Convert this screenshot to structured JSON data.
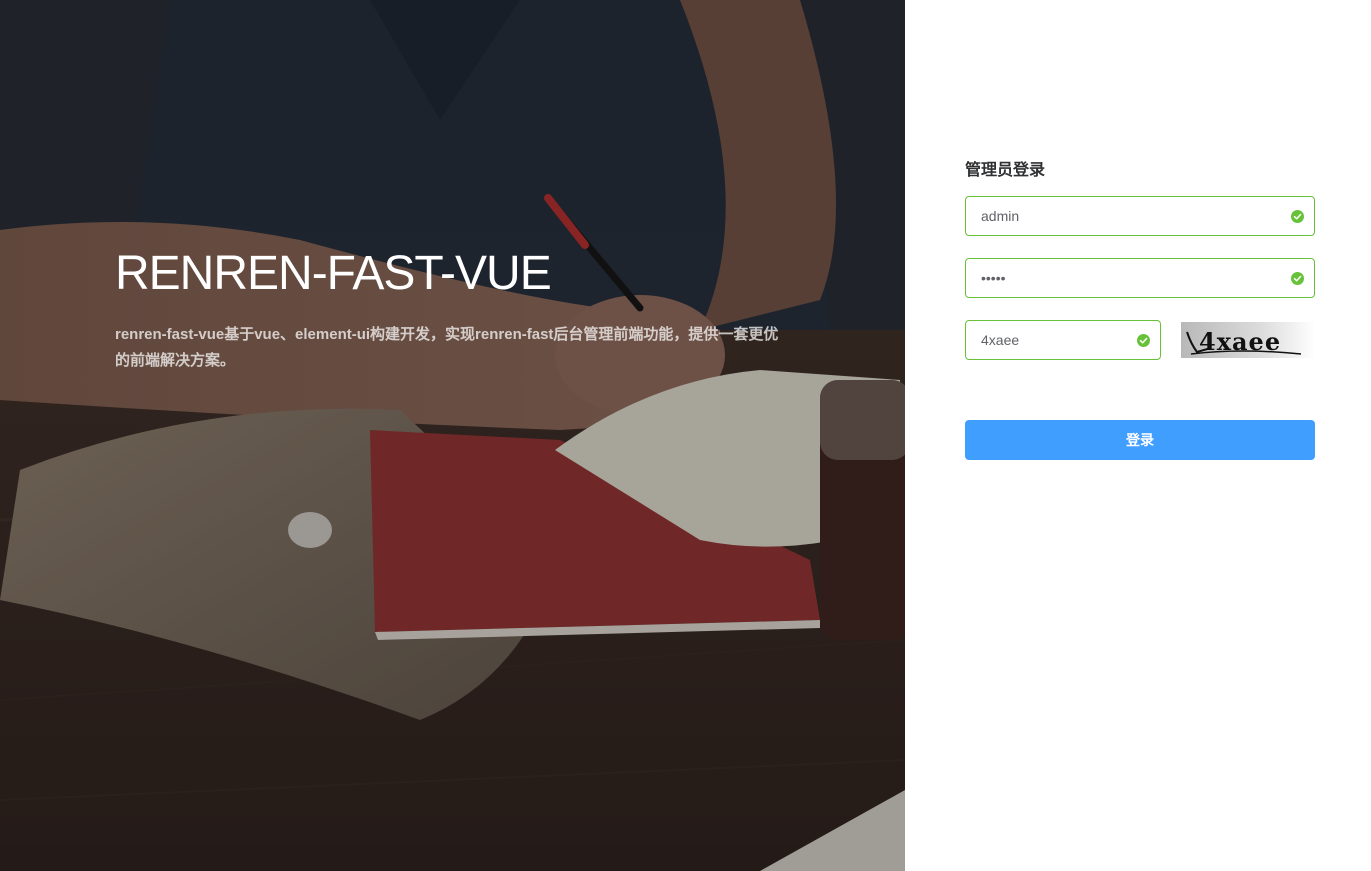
{
  "hero": {
    "title": "RENREN-FAST-VUE",
    "description": "renren-fast-vue基于vue、element-ui构建开发，实现renren-fast后台管理前端功能，提供一套更优的前端解决方案。"
  },
  "login": {
    "title": "管理员登录",
    "username_value": "admin",
    "password_value": "•••••",
    "captcha_value": "4xaee",
    "captcha_image_text": "4xaee",
    "submit_label": "登录"
  },
  "colors": {
    "valid": "#67c23a",
    "primary": "#409eff"
  }
}
